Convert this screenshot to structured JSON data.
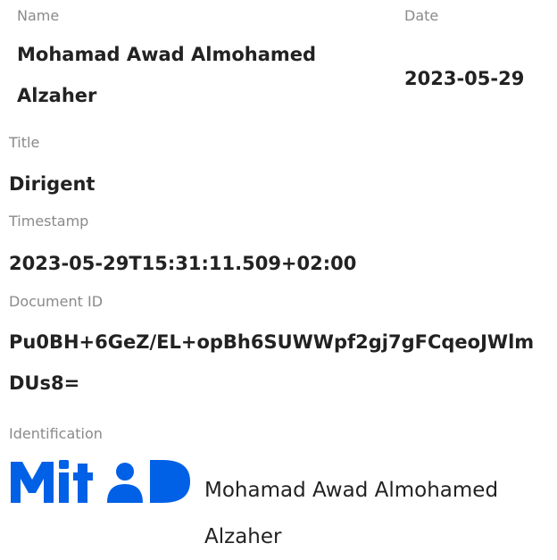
{
  "fields": {
    "name": {
      "label": "Name",
      "value": "Mohamad Awad Almohamed Alzaher"
    },
    "date": {
      "label": "Date",
      "value": "2023-05-29"
    },
    "title": {
      "label": "Title",
      "value": "Dirigent"
    },
    "timestamp": {
      "label": "Timestamp",
      "value": "2023-05-29T15:31:11.509+02:00"
    },
    "document_id": {
      "label": "Document ID",
      "value": "Pu0BH+6GeZ/EL+opBh6SUWWpf2gj7gFCqeoJWlmDUs8="
    },
    "identification": {
      "label": "Identification",
      "provider_logo_text": "MitID",
      "value": "Mohamad Awad Almohamed Alzaher"
    }
  },
  "colors": {
    "label": "#8a8a8a",
    "value": "#222222",
    "mitid_blue": "#0060e6"
  },
  "icons": {
    "identification_logo": "mitid-logo"
  }
}
